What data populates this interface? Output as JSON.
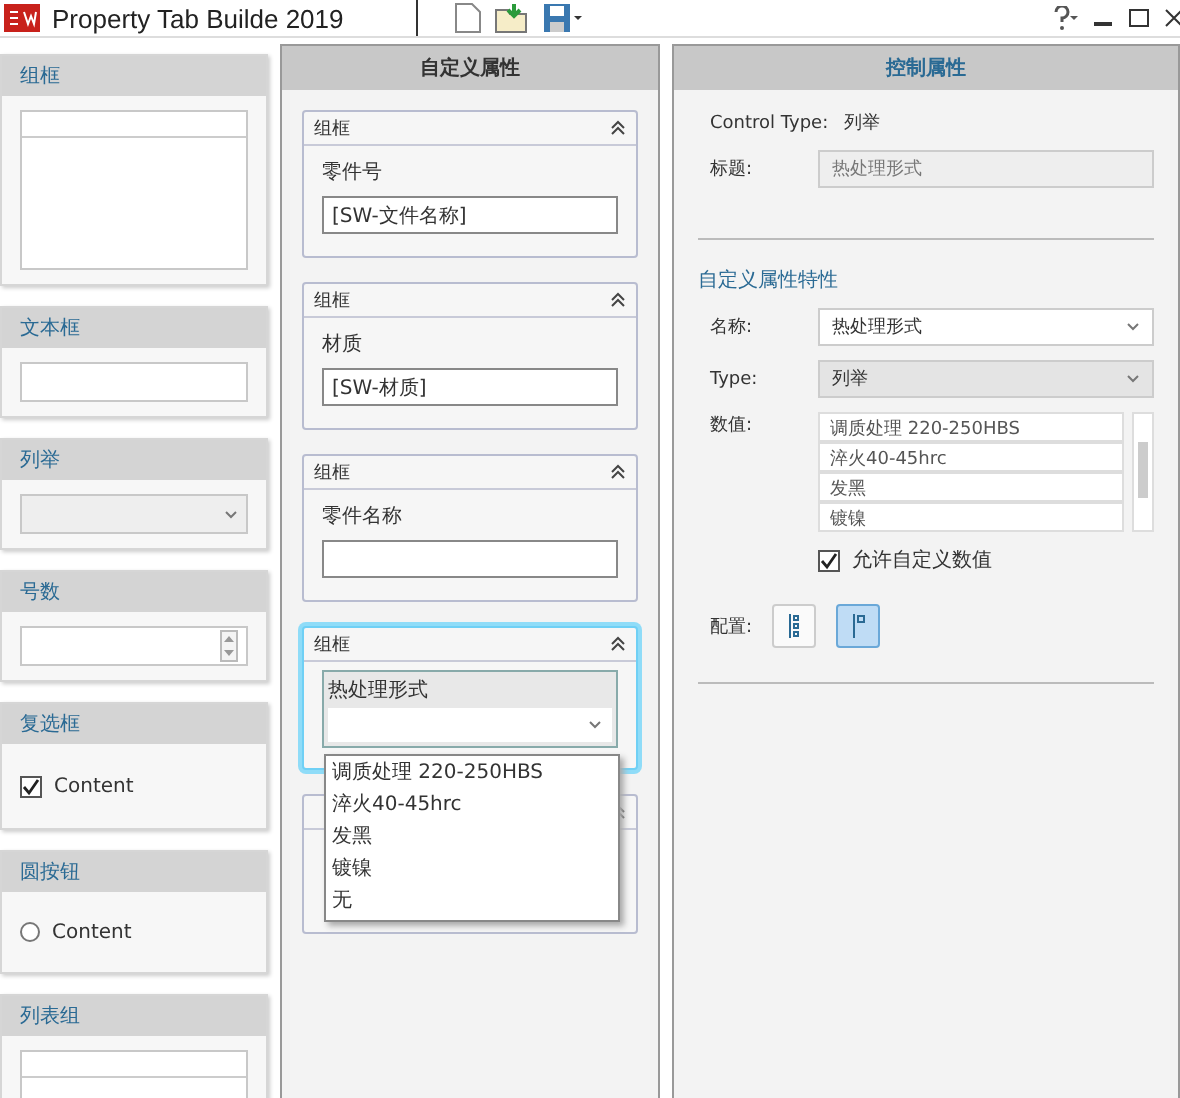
{
  "title_bar": {
    "app_title": "Property Tab Builde 2019"
  },
  "palette": [
    {
      "label": "组框",
      "kind": "groupbox"
    },
    {
      "label": "文本框",
      "kind": "textbox"
    },
    {
      "label": "列举",
      "kind": "list"
    },
    {
      "label": "号数",
      "kind": "number"
    },
    {
      "label": "复选框",
      "kind": "checkbox",
      "content": "Content",
      "checked": true
    },
    {
      "label": "圆按钮",
      "kind": "radio",
      "content": "Content",
      "checked": false
    },
    {
      "label": "列表组",
      "kind": "listgroup"
    }
  ],
  "custom_properties": {
    "title": "自定义属性",
    "groups": [
      {
        "title": "组框",
        "kind": "text",
        "label": "零件号",
        "value": "[SW-文件名称]",
        "selected": false
      },
      {
        "title": "组框",
        "kind": "text",
        "label": "材质",
        "value": "[SW-材质]",
        "selected": false
      },
      {
        "title": "组框",
        "kind": "text",
        "label": "零件名称",
        "selected": false
      },
      {
        "title": "组框",
        "kind": "dropdown",
        "label": "热处理形式",
        "selected": true,
        "expanded": true,
        "options": [
          "调质处理 220-250HBS",
          "淬火40-45hrc",
          "发黑",
          "镀镍",
          "无"
        ]
      },
      {
        "kind": "hidden",
        "selected": false
      }
    ]
  },
  "control_properties": {
    "title": "控制属性",
    "control_type_label": "Control Type:",
    "control_type": "列举",
    "caption_label": "标题:",
    "caption": "热处理形式",
    "section": "自定义属性特性",
    "name_label": "名称:",
    "name": "热处理形式",
    "type_label": "Type:",
    "type": "列举",
    "values_label": "数值:",
    "values": [
      "调质处理 220-250HBS",
      "淬火40-45hrc",
      "发黑",
      "镀镍"
    ],
    "allow_custom": {
      "label": "允许自定义数值",
      "checked": true
    },
    "layout_label": "配置:",
    "layouts": [
      {
        "selected": false
      },
      {
        "selected": true
      }
    ]
  }
}
